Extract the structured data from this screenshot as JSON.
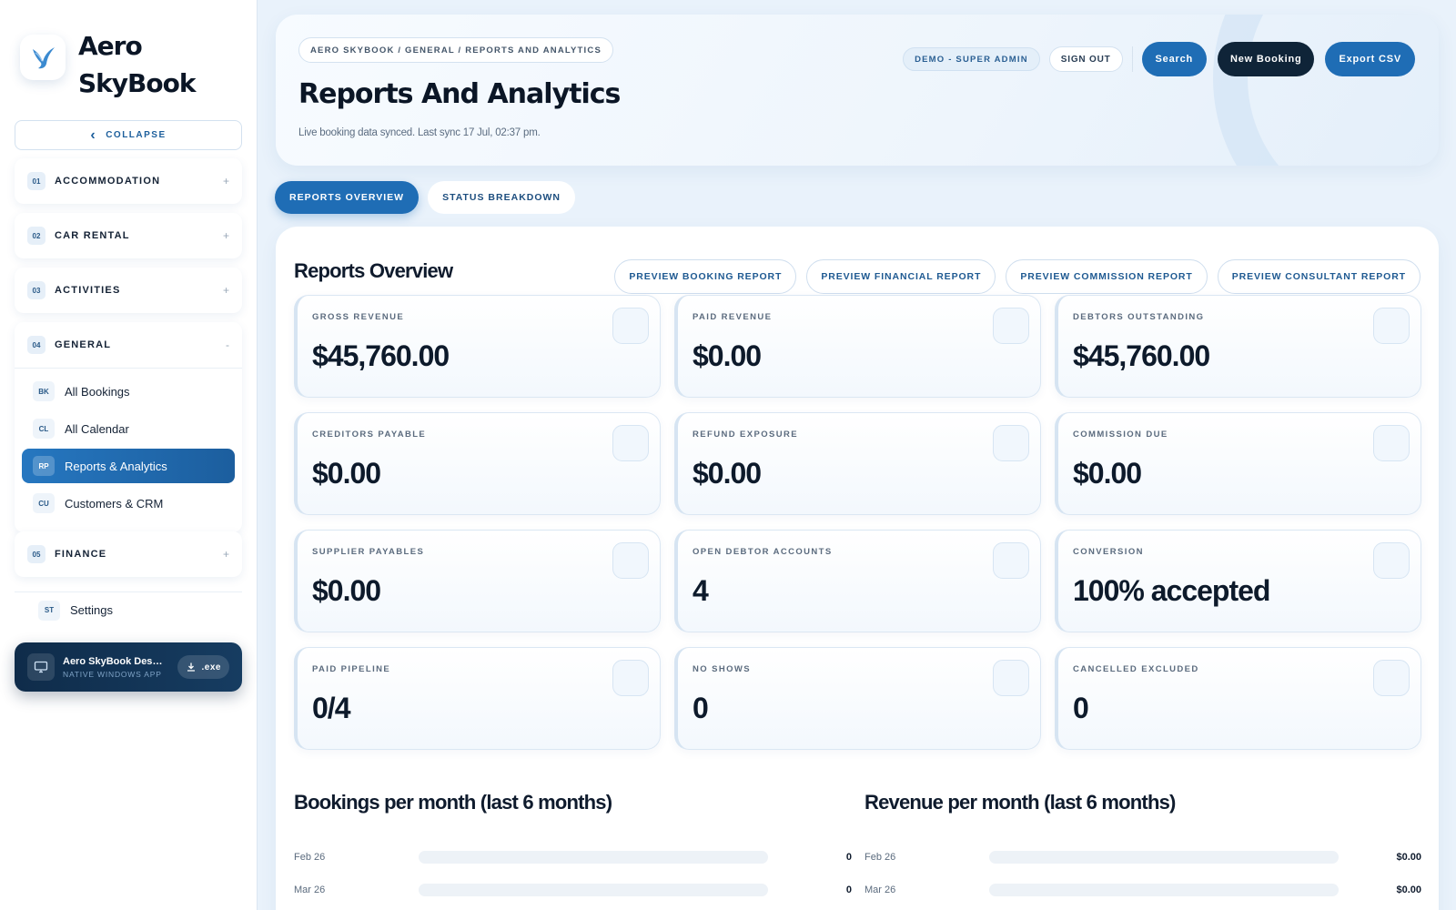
{
  "brand": {
    "name_line1": "Aero",
    "name_line2": "SkyBook"
  },
  "sidebar": {
    "collapse_label": "COLLAPSE",
    "sections": [
      {
        "num": "01",
        "label": "ACCOMMODATION",
        "toggle": "+"
      },
      {
        "num": "02",
        "label": "CAR RENTAL",
        "toggle": "+"
      },
      {
        "num": "03",
        "label": "ACTIVITIES",
        "toggle": "+"
      },
      {
        "num": "04",
        "label": "GENERAL",
        "toggle": "-"
      },
      {
        "num": "05",
        "label": "FINANCE",
        "toggle": "+"
      }
    ],
    "general_items": [
      {
        "badge": "BK",
        "label": "All Bookings"
      },
      {
        "badge": "CL",
        "label": "All Calendar"
      },
      {
        "badge": "RP",
        "label": "Reports & Analytics"
      },
      {
        "badge": "CU",
        "label": "Customers & CRM"
      }
    ],
    "settings": {
      "badge": "ST",
      "label": "Settings"
    },
    "desktop_app": {
      "title": "Aero SkyBook Desktop",
      "subtitle": "NATIVE WINDOWS APP",
      "download_label": ".exe"
    }
  },
  "header": {
    "breadcrumb": "AERO SKYBOOK / GENERAL / REPORTS AND ANALYTICS",
    "title": "Reports And Analytics",
    "sync_text": "Live booking data synced. Last sync 17 Jul, 02:37 pm.",
    "role_badge": "DEMO - SUPER ADMIN",
    "sign_out": "SIGN OUT",
    "search": "Search",
    "new_booking": "New Booking",
    "export": "Export CSV"
  },
  "tabs": [
    {
      "label": "REPORTS OVERVIEW",
      "active": true
    },
    {
      "label": "STATUS BREAKDOWN",
      "active": false
    }
  ],
  "overview": {
    "title": "Reports Overview",
    "preview_buttons": [
      "PREVIEW BOOKING REPORT",
      "PREVIEW FINANCIAL REPORT",
      "PREVIEW COMMISSION REPORT",
      "PREVIEW CONSULTANT REPORT"
    ],
    "stats": [
      {
        "label": "GROSS REVENUE",
        "value": "$45,760.00"
      },
      {
        "label": "PAID REVENUE",
        "value": "$0.00"
      },
      {
        "label": "DEBTORS OUTSTANDING",
        "value": "$45,760.00"
      },
      {
        "label": "CREDITORS PAYABLE",
        "value": "$0.00"
      },
      {
        "label": "REFUND EXPOSURE",
        "value": "$0.00"
      },
      {
        "label": "COMMISSION DUE",
        "value": "$0.00"
      },
      {
        "label": "SUPPLIER PAYABLES",
        "value": "$0.00"
      },
      {
        "label": "OPEN DEBTOR ACCOUNTS",
        "value": "4"
      },
      {
        "label": "CONVERSION",
        "value": "100% accepted"
      },
      {
        "label": "PAID PIPELINE",
        "value": "0/4"
      },
      {
        "label": "NO SHOWS",
        "value": "0"
      },
      {
        "label": "CANCELLED EXCLUDED",
        "value": "0"
      }
    ]
  },
  "bookings_chart": {
    "title": "Bookings per month (last 6 months)",
    "rows": [
      {
        "month": "Feb 26",
        "value": 0,
        "display": "0"
      },
      {
        "month": "Mar 26",
        "value": 0,
        "display": "0"
      }
    ]
  },
  "revenue_chart": {
    "title": "Revenue per month (last 6 months)",
    "rows": [
      {
        "month": "Feb 26",
        "value": 0,
        "display": "$0.00"
      },
      {
        "month": "Mar 26",
        "value": 0,
        "display": "$0.00"
      }
    ]
  },
  "colors": {
    "accent": "#1f6db5",
    "dark": "#0f2438",
    "background": "#e9f2fb"
  }
}
